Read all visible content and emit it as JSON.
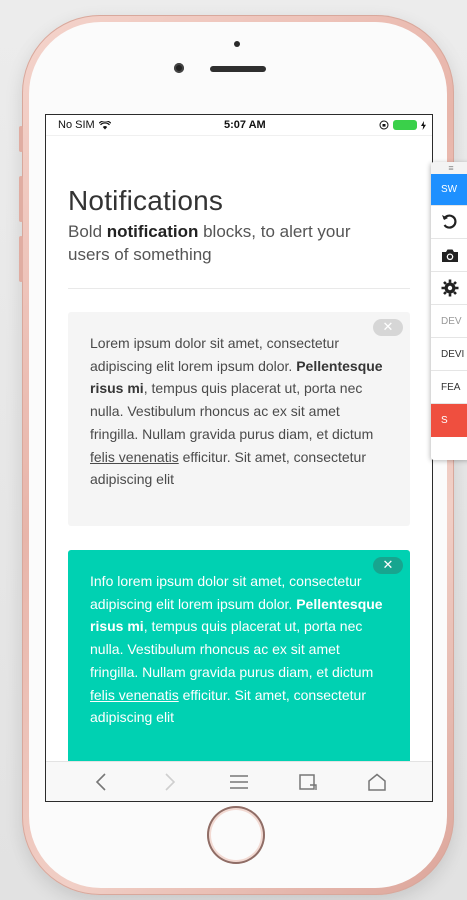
{
  "status_bar": {
    "carrier": "No SIM",
    "time": "5:07 AM"
  },
  "page": {
    "title": "Notifications",
    "subtitle_pre": "Bold ",
    "subtitle_bold": "notification",
    "subtitle_post": " blocks, to alert your users of something"
  },
  "notifications": [
    {
      "variant": "default",
      "text_1": "Lorem ipsum dolor sit amet, consectetur adipiscing elit lorem ipsum dolor. ",
      "bold": "Pellentesque risus mi",
      "text_2": ", tempus quis placerat ut, porta nec nulla. Vestibulum rhoncus ac ex sit amet fringilla. Nullam gravida purus diam, et dictum ",
      "link": "felis venenatis",
      "text_3": " efficitur. Sit amet, consectetur adipiscing elit",
      "color": "#f5f5f5"
    },
    {
      "variant": "info",
      "text_1": "Info lorem ipsum dolor sit amet, consectetur adipiscing elit lorem ipsum dolor. ",
      "bold": "Pellentesque risus mi",
      "text_2": ", tempus quis placerat ut, porta nec nulla. Vestibulum rhoncus ac ex sit amet fringilla. Nullam gravida purus diam, et dictum ",
      "link": "felis venenatis",
      "text_3": " efficitur. Sit amet, consectetur adipiscing elit",
      "color": "#00d1b2"
    }
  ],
  "delete_glyph": "✕",
  "toolbar_icons": [
    "back-icon",
    "forward-icon",
    "menu-icon",
    "tabs-icon",
    "home-icon"
  ],
  "side_panel": {
    "handle": "≡",
    "items": [
      "SW",
      "↺",
      "camera-icon",
      "gear-icon",
      "DEV",
      "DEVI",
      "FEA",
      "S"
    ]
  },
  "colors": {
    "accent_info": "#00d1b2",
    "side_blue": "#1e90ff",
    "side_red": "#ef4f3f",
    "phone_rose": "#e8b5aa"
  }
}
